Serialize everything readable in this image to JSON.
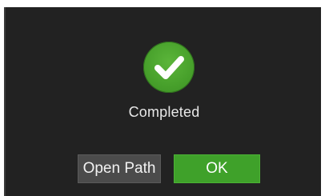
{
  "dialog": {
    "status_text": "Completed",
    "status_icon": "check-circle-icon",
    "buttons": {
      "open_path_label": "Open Path",
      "ok_label": "OK"
    }
  },
  "colors": {
    "dialog_background": "#222222",
    "success_green": "#47a02b",
    "ok_button": "#3fa12a",
    "secondary_button": "#4b4b4b"
  }
}
